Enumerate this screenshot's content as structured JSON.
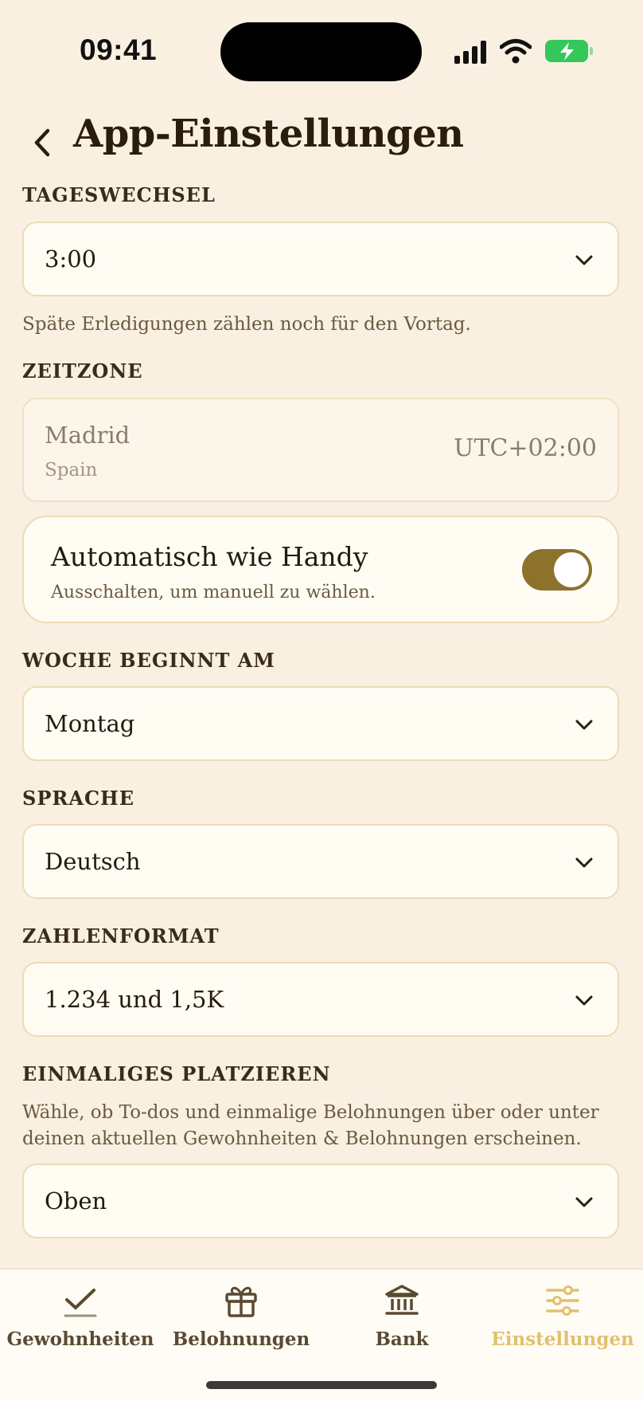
{
  "status_bar": {
    "time": "09:41"
  },
  "header": {
    "title": "App-Einstellungen"
  },
  "day_change": {
    "label": "TAGESWECHSEL",
    "value": "3:00",
    "help": "Späte Erledigungen zählen noch für den Vortag."
  },
  "timezone": {
    "label": "ZEITZONE",
    "city": "Madrid",
    "country": "Spain",
    "offset": "UTC+02:00"
  },
  "auto_timezone": {
    "title": "Automatisch wie Handy",
    "subtitle": "Ausschalten, um manuell zu wählen.",
    "enabled": true
  },
  "week_start": {
    "label": "WOCHE BEGINNT AM",
    "value": "Montag"
  },
  "language": {
    "label": "SPRACHE",
    "value": "Deutsch"
  },
  "number_format": {
    "label": "ZAHLENFORMAT",
    "value": "1.234 und 1,5K"
  },
  "one_time_placement": {
    "label": "EINMALIGES PLATZIEREN",
    "help_line1": "Wähle, ob To-dos und einmalige Belohnungen über oder unter",
    "help_line2": "deinen aktuellen Gewohnheiten & Belohnungen erscheinen.",
    "value": "Oben"
  },
  "tabbar": {
    "items": [
      {
        "label": "Gewohnheiten",
        "icon": "checkmark-icon"
      },
      {
        "label": "Belohnungen",
        "icon": "gift-icon"
      },
      {
        "label": "Bank",
        "icon": "bank-icon"
      },
      {
        "label": "Einstellungen",
        "icon": "sliders-icon",
        "active": true
      }
    ]
  },
  "colors": {
    "background": "#f9f0e2",
    "accent": "#8c722b",
    "active_tab": "#e2c06d"
  }
}
